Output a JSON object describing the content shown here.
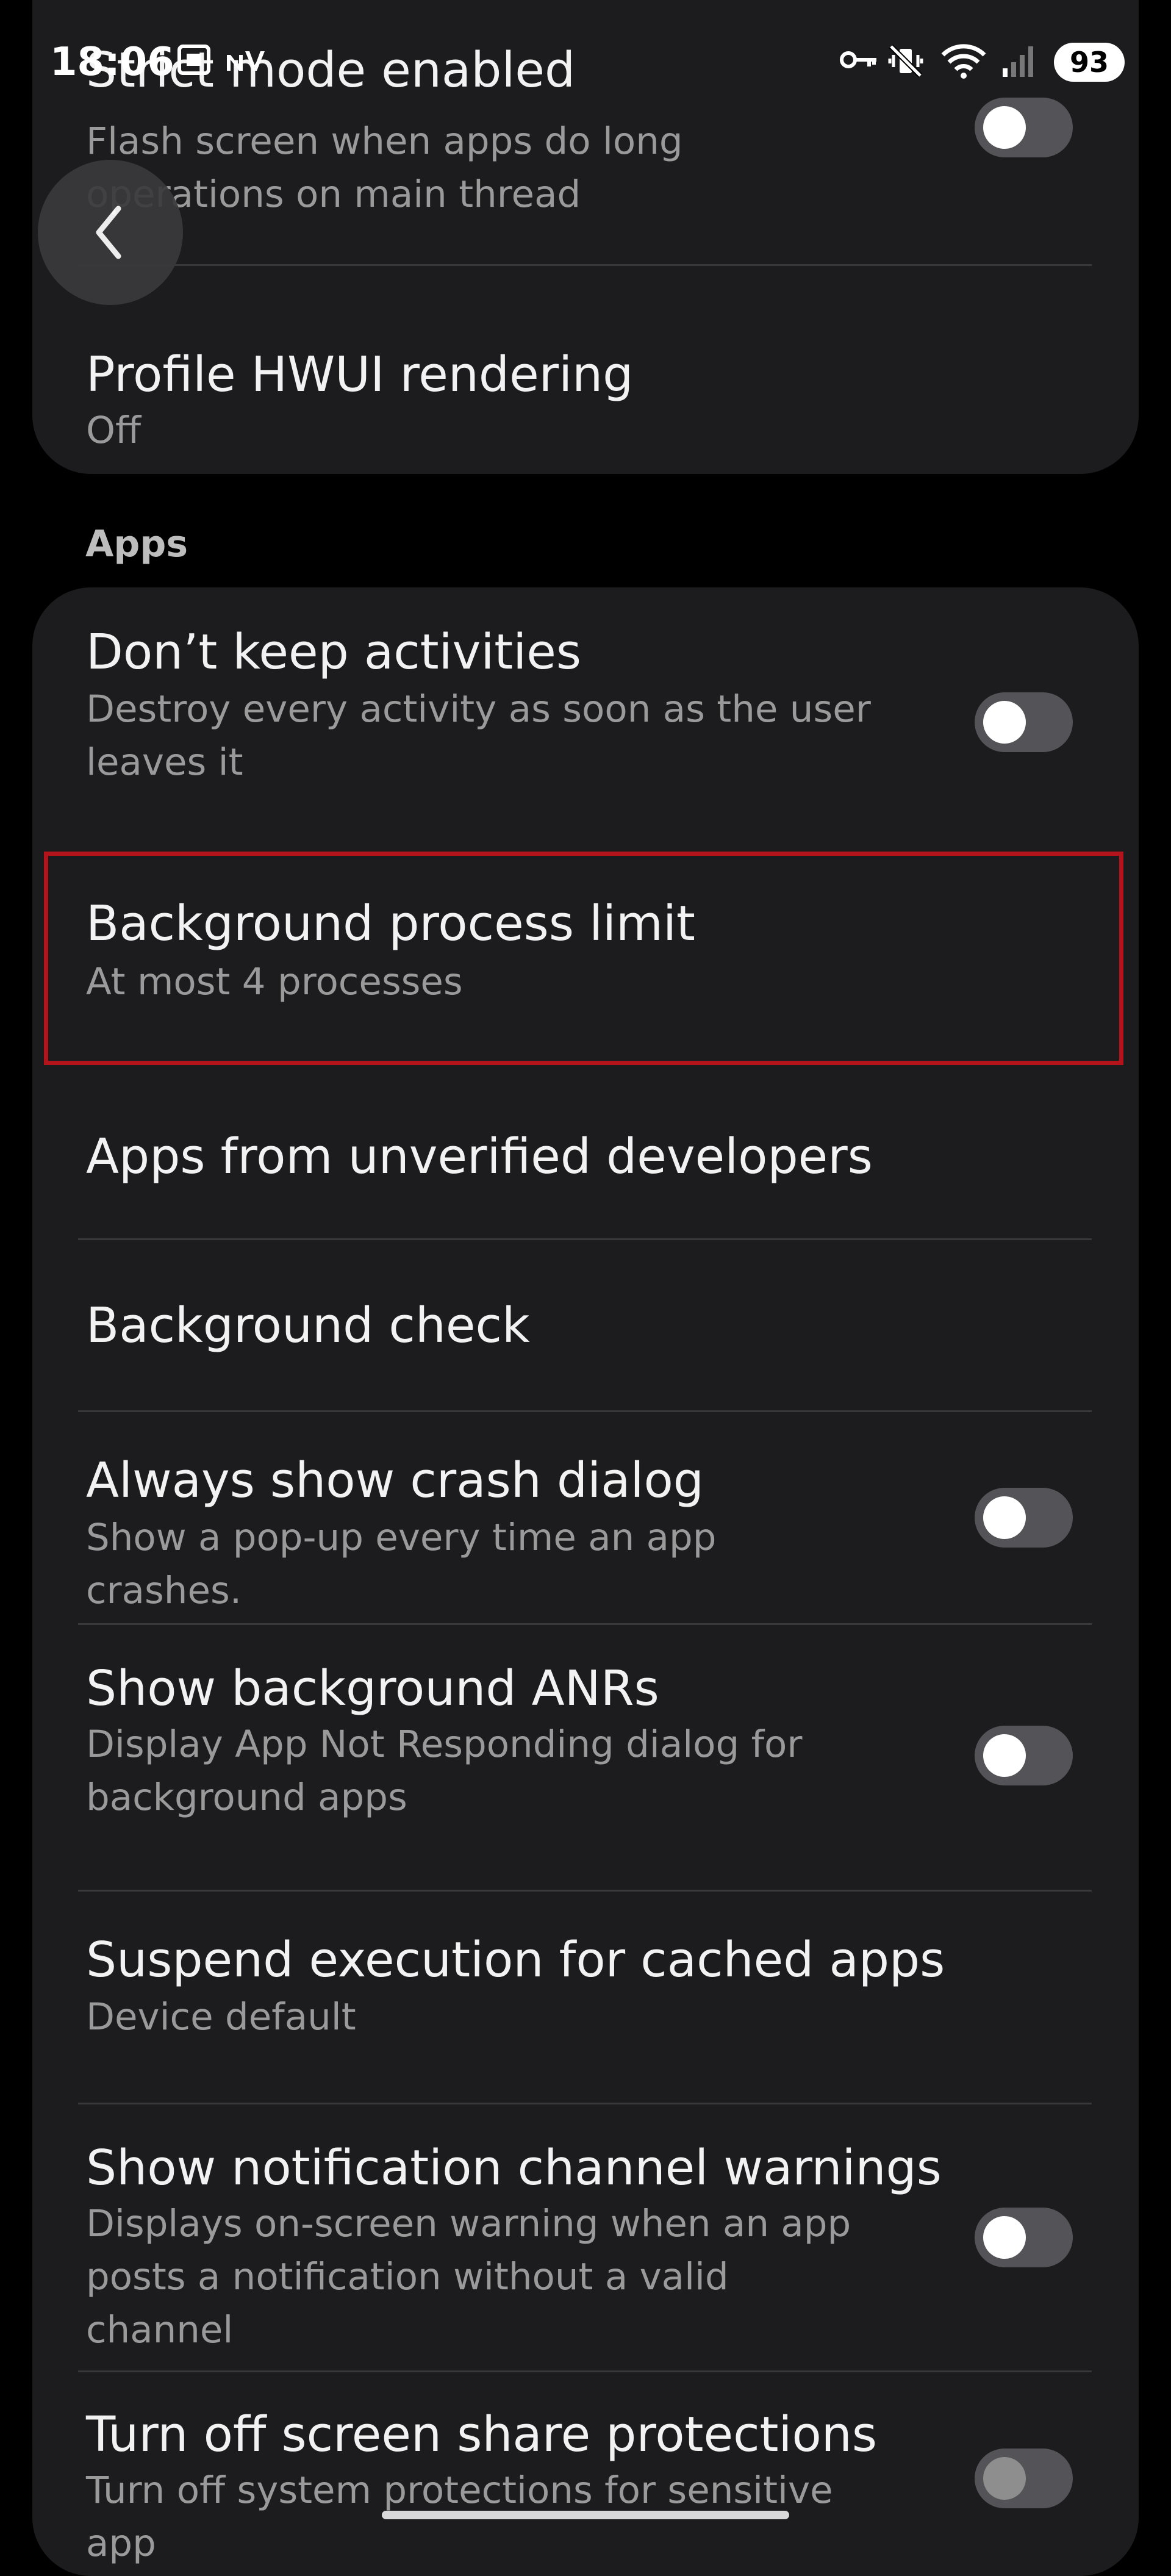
{
  "status_bar": {
    "time": "18:06",
    "battery": "93",
    "icons": [
      "screen-record-icon",
      "nv-indicator-icon",
      "vpn-key-icon",
      "vibrate-mute-icon",
      "wifi-icon",
      "signal-icon"
    ]
  },
  "top_group": {
    "items": [
      {
        "title": "Strict mode enabled",
        "subtitle": "Flash screen when apps do long operations on main thread",
        "toggle": "off"
      },
      {
        "title": "Profile HWUI rendering",
        "subtitle": "Off"
      }
    ]
  },
  "apps_section": {
    "header": "Apps",
    "items": [
      {
        "title": "Don’t keep activities",
        "subtitle": "Destroy every activity as soon as the user leaves it",
        "toggle": "off"
      },
      {
        "title": "Background process limit",
        "subtitle": "At most 4 processes",
        "highlighted": true
      },
      {
        "title": "Apps from unverified developers"
      },
      {
        "title": "Background check"
      },
      {
        "title": "Always show crash dialog",
        "subtitle": "Show a pop-up every time an app crashes.",
        "toggle": "off"
      },
      {
        "title": "Show background ANRs",
        "subtitle": "Display App Not Responding dialog for background apps",
        "toggle": "off"
      },
      {
        "title": "Suspend execution for cached apps",
        "subtitle": "Device default"
      },
      {
        "title": "Show notification channel warnings",
        "subtitle": "Displays on-screen warning when an app posts a notification without a valid channel",
        "toggle": "off"
      },
      {
        "title": "Turn off screen share protections",
        "subtitle": "Turn off system protections for sensitive app",
        "toggle": "off"
      }
    ]
  },
  "colors": {
    "background": "#000000",
    "card": "#1c1c1e",
    "highlight_border": "#b3141c",
    "toggle_track_off": "#545458"
  }
}
